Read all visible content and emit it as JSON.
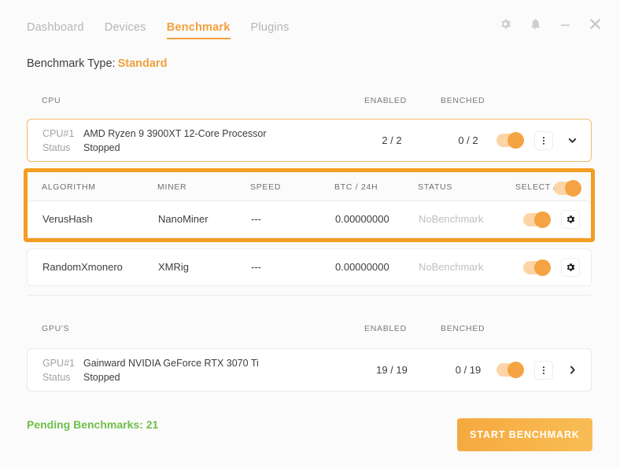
{
  "nav": {
    "tabs": [
      {
        "label": "Dashboard",
        "active": false
      },
      {
        "label": "Devices",
        "active": false
      },
      {
        "label": "Benchmark",
        "active": true
      },
      {
        "label": "Plugins",
        "active": false
      }
    ],
    "window_controls": [
      {
        "name": "settings-icon",
        "label": "Settings"
      },
      {
        "name": "notifications-icon",
        "label": "Notifications"
      },
      {
        "name": "minimize-icon",
        "label": "Minimize"
      },
      {
        "name": "close-icon",
        "label": "Close"
      }
    ]
  },
  "benchmark_type": {
    "label": "Benchmark Type:",
    "value": "Standard"
  },
  "cpu_section": {
    "header": {
      "name": "CPU",
      "enabled": "ENABLED",
      "benched": "BENCHED"
    },
    "device": {
      "id_key": "CPU#1",
      "id_value": "AMD Ryzen 9 3900XT 12-Core Processor",
      "status_key": "Status",
      "status_value": "Stopped",
      "enabled": "2 / 2",
      "benched": "0 / 2",
      "toggle_on": true,
      "menu_icon": "more-vertical-icon",
      "expand_icon": "chevron-down-icon"
    }
  },
  "algorithms": {
    "header": {
      "algorithm": "ALGORITHM",
      "miner": "MINER",
      "speed": "SPEED",
      "btc": "BTC / 24H",
      "status": "STATUS",
      "select_all": "SELECT ALL",
      "select_all_on": true
    },
    "rows": [
      {
        "algorithm": "VerusHash",
        "miner": "NanoMiner",
        "speed": "---",
        "btc": "0.00000000",
        "status": "NoBenchmark",
        "toggle_on": true,
        "settings_icon": "gear-icon",
        "highlighted": true
      },
      {
        "algorithm": "RandomXmonero",
        "miner": "XMRig",
        "speed": "---",
        "btc": "0.00000000",
        "status": "NoBenchmark",
        "toggle_on": true,
        "settings_icon": "gear-icon",
        "highlighted": false
      }
    ]
  },
  "gpu_section": {
    "header": {
      "name": "GPU'S",
      "enabled": "ENABLED",
      "benched": "BENCHED"
    },
    "device": {
      "id_key": "GPU#1",
      "id_value": "Gainward NVIDIA GeForce RTX 3070 Ti",
      "status_key": "Status",
      "status_value": "Stopped",
      "enabled": "19 / 19",
      "benched": "0 / 19",
      "toggle_on": true,
      "menu_icon": "more-vertical-icon",
      "expand_icon": "chevron-right-icon"
    }
  },
  "footer": {
    "pending_label": "Pending Benchmarks: 21",
    "start_button": "START BENCHMARK"
  },
  "colors": {
    "accent": "#f2a03d",
    "highlight_border": "#f59c22",
    "pending_green": "#6fbf4a",
    "muted_text": "#bfbfbf",
    "background": "#fbfbfb"
  }
}
